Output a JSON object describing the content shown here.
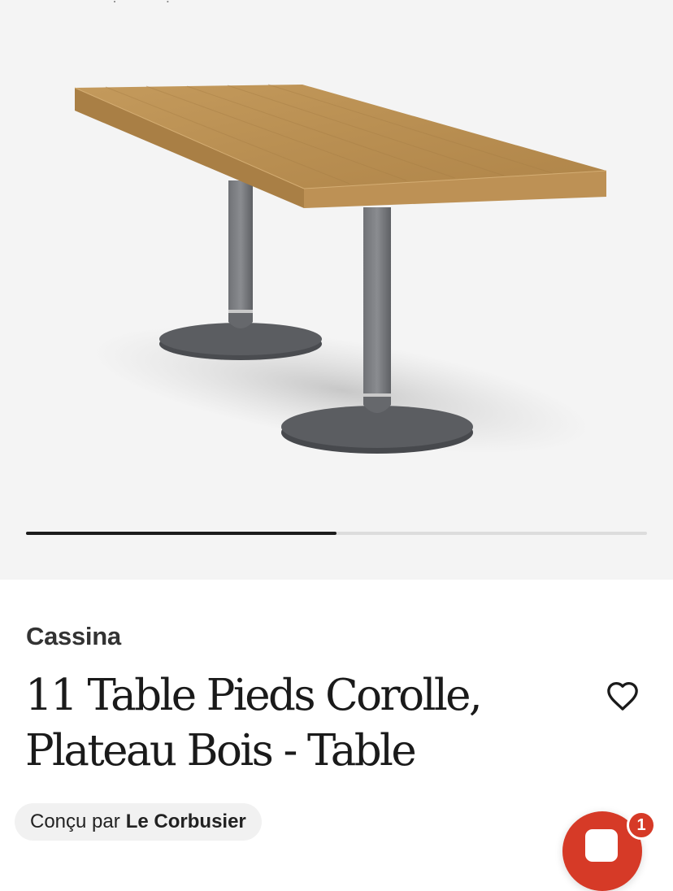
{
  "gallery": {
    "image_alt": "11 Table Pieds Corolle, Plateau Bois",
    "current_fraction": 0.5
  },
  "product": {
    "brand": "Cassina",
    "title": "11 Table Pieds Corolle, Plateau Bois - Table",
    "designer_prefix": "Conçu par",
    "designer_name": "Le Corbusier"
  },
  "icons": {
    "wishlist": "heart-outline-icon",
    "chat": "chat-bubble-icon"
  },
  "chat": {
    "badge_count": "1"
  },
  "colors": {
    "gallery_background": "#f4f4f4",
    "progress_active": "#1c1c1c",
    "progress_track": "#dcdcdc",
    "chat_accent": "#d63a27",
    "pill_background": "#f1f1f1"
  }
}
